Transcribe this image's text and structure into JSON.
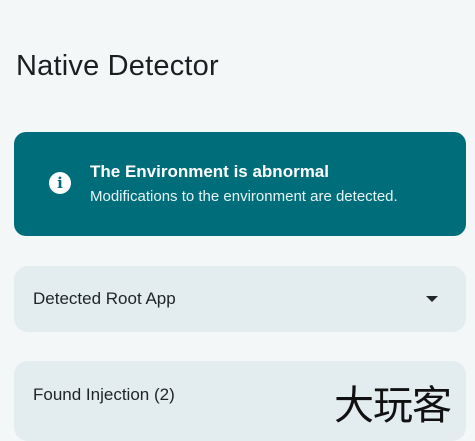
{
  "app": {
    "title": "Native Detector"
  },
  "alert": {
    "icon": "info-icon",
    "icon_glyph": "i",
    "title": "The Environment is abnormal",
    "message": "Modifications to the environment are detected.",
    "background_color": "#006e7a"
  },
  "sections": [
    {
      "label": "Detected Root App",
      "icon": "chevron-down-icon"
    },
    {
      "label": "Found Injection (2)"
    }
  ],
  "watermark": {
    "text": "大玩客"
  }
}
